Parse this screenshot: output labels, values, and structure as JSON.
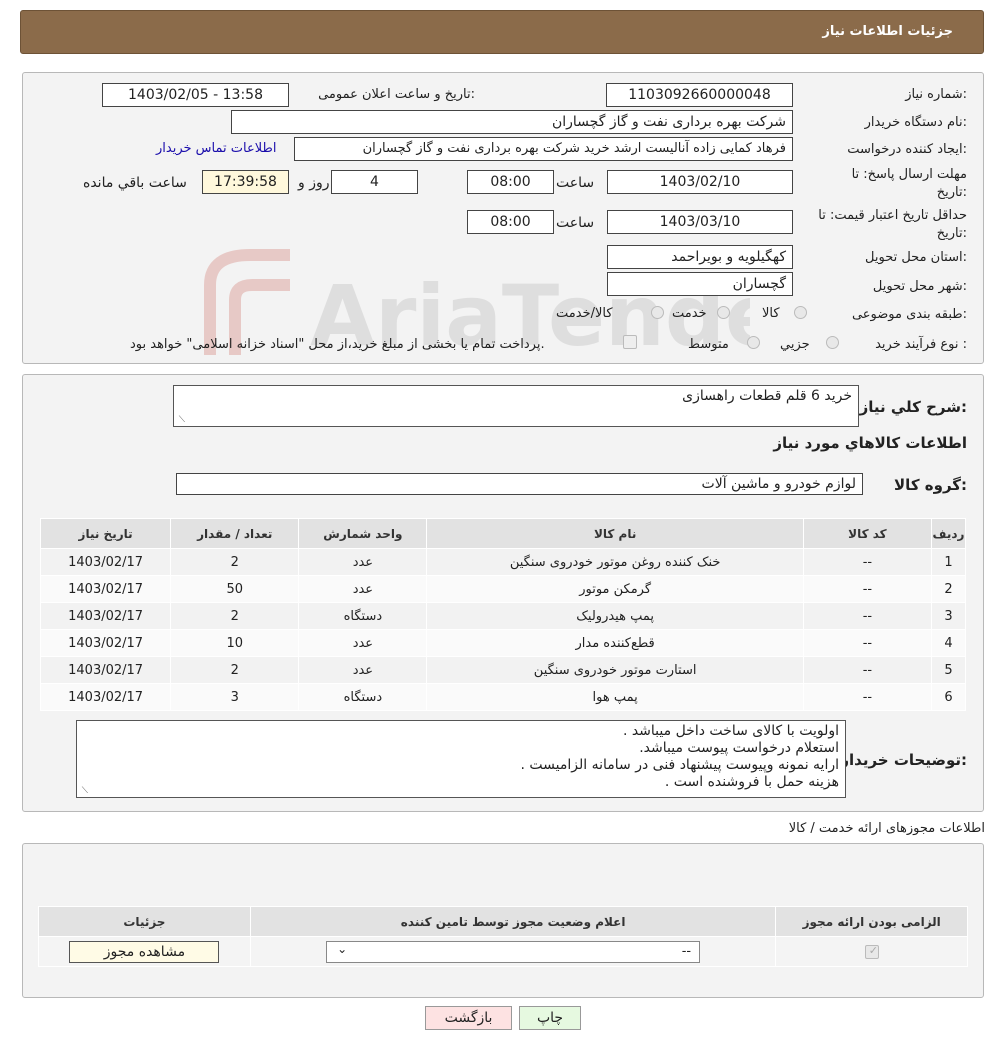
{
  "header": {
    "title": "جزئیات اطلاعات نیاز"
  },
  "info": {
    "need_number_label": "شماره نیاز:",
    "need_number": "1103092660000048",
    "announce_label": "تاریخ و ساعت اعلان عمومی:",
    "announce_value": "1403/02/05 - 13:58",
    "buyer_label": "نام دستگاه خریدار:",
    "buyer_value": "شرکت بهره برداری نفت و گاز گچساران",
    "creator_label": "ایجاد کننده درخواست:",
    "creator_value": "فرهاد کمایی زاده آنالیست ارشد خرید شرکت بهره برداری نفت و گاز گچساران",
    "contact_link": "اطلاعات تماس خریدار",
    "deadline_label_1": "مهلت ارسال پاسخ: تا",
    "deadline_label_2": "تاریخ:",
    "deadline_date": "1403/02/10",
    "time_label": "ساعت",
    "deadline_time": "08:00",
    "days_value": "4",
    "days_label": "روز و",
    "remaining_time": "17:39:58",
    "remaining_label": "ساعت باقي مانده",
    "validity_label_1": "حداقل تاریخ اعتبار قیمت: تا",
    "validity_label_2": "تاریخ:",
    "validity_date": "1403/03/10",
    "validity_time": "08:00",
    "province_label": "استان محل تحویل:",
    "province_value": "کهگیلویه و بویراحمد",
    "city_label": "شهر محل تحویل:",
    "city_value": "گچساران",
    "category_label": "طبقه بندی موضوعی:",
    "category_options": [
      "کالا",
      "خدمت",
      "کالا/خدمت"
    ],
    "process_label": "نوع فرآیند خرید :",
    "process_options": [
      "جزیي",
      "متوسط"
    ],
    "payment_note": "پرداخت تمام یا بخشی از مبلغ خرید،از محل \"اسناد خزانه اسلامی\" خواهد بود."
  },
  "summary": {
    "desc_label": "شرح كلي نياز:",
    "desc_value": "خرید 6 قلم قطعات راهسازی",
    "goods_title": "اطلاعات كالاهاي مورد نياز",
    "group_label": "گروه کالا:",
    "group_value": "لوازم خودرو و ماشین آلات",
    "columns": [
      "ردیف",
      "کد کالا",
      "نام کالا",
      "واحد شمارش",
      "تعداد / مقدار",
      "تاریخ نیاز"
    ],
    "rows": [
      {
        "n": "1",
        "code": "--",
        "name": "خنک کننده روغن موتور خودروی سنگین",
        "unit": "عدد",
        "qty": "2",
        "date": "1403/02/17"
      },
      {
        "n": "2",
        "code": "--",
        "name": "گرمکن موتور",
        "unit": "عدد",
        "qty": "50",
        "date": "1403/02/17"
      },
      {
        "n": "3",
        "code": "--",
        "name": "پمپ هیدرولیک",
        "unit": "دستگاه",
        "qty": "2",
        "date": "1403/02/17"
      },
      {
        "n": "4",
        "code": "--",
        "name": "قطع‌کننده مدار",
        "unit": "عدد",
        "qty": "10",
        "date": "1403/02/17"
      },
      {
        "n": "5",
        "code": "--",
        "name": "استارت موتور خودروی سنگین",
        "unit": "عدد",
        "qty": "2",
        "date": "1403/02/17"
      },
      {
        "n": "6",
        "code": "--",
        "name": "پمپ هوا",
        "unit": "دستگاه",
        "qty": "3",
        "date": "1403/02/17"
      }
    ],
    "notes_label": "توضیحات خریدار:",
    "notes_lines": [
      "اولویت با کالای ساخت داخل میباشد .",
      "استعلام درخواست پیوست میباشد.",
      "ارایه نمونه وپیوست پیشنهاد فنی در سامانه الزامیست .",
      "هزینه حمل با فروشنده است ."
    ]
  },
  "permits": {
    "title": "اطلاعات مجوزهای ارائه خدمت / کالا",
    "col_required": "الزامی بودن ارائه مجوز",
    "col_status": "اعلام وضعیت مجوز توسط تامین کننده",
    "col_details": "جزئیات",
    "select_value": "--",
    "view_button": "مشاهده مجوز"
  },
  "buttons": {
    "print": "چاپ",
    "back": "بازگشت"
  },
  "watermark_text": "AriaTender.neT",
  "colors": {
    "header": "#8b6b4a",
    "link": "#1a0dab",
    "print_btn": "#e6f9e0",
    "back_btn": "#fde2e2"
  }
}
